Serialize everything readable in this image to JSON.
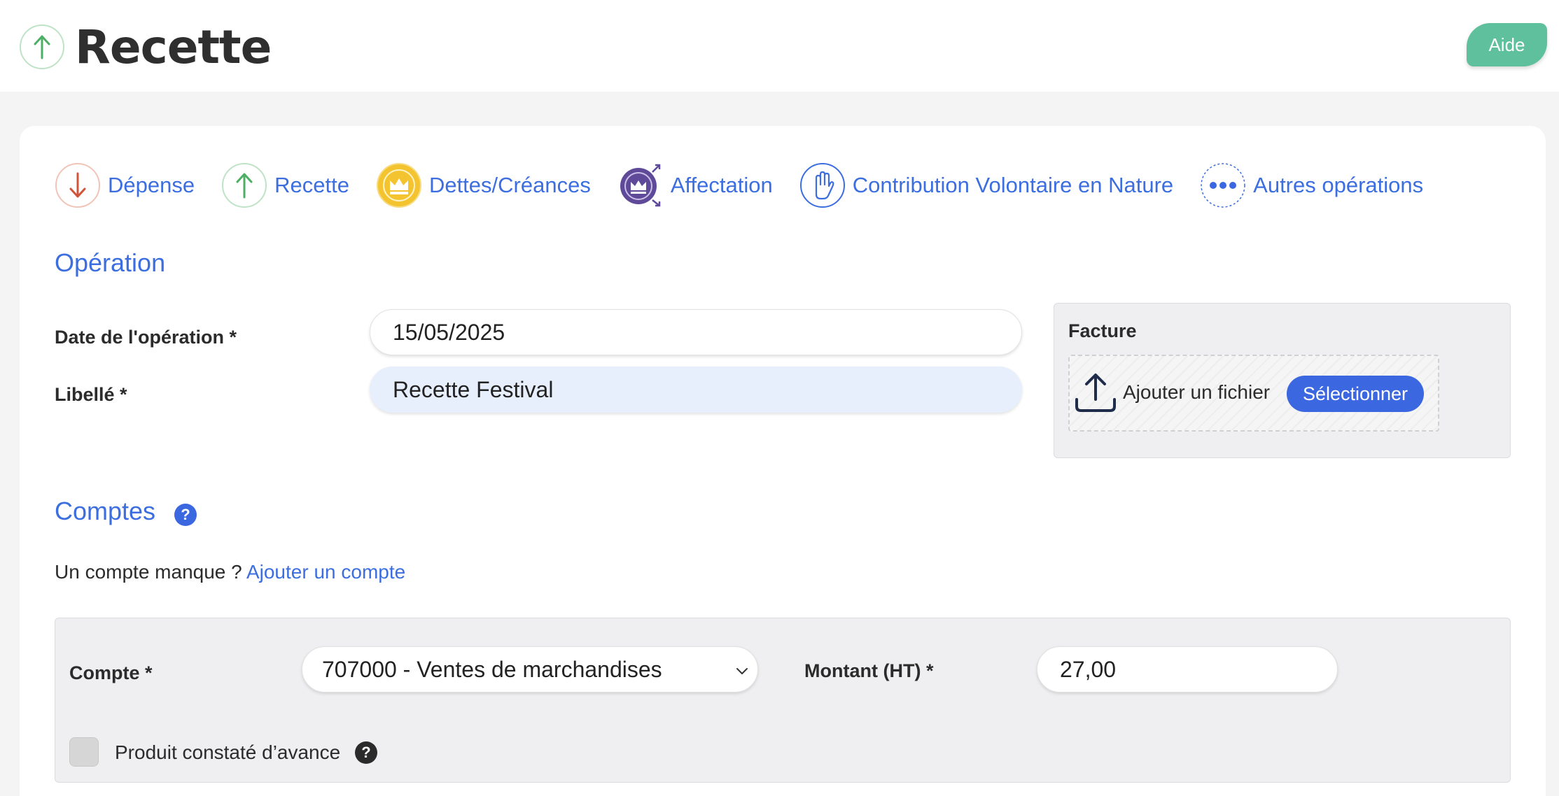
{
  "header": {
    "title": "Recette",
    "help_label": "Aide"
  },
  "tabs": [
    {
      "label": "Dépense",
      "icon": "arrow-down-icon"
    },
    {
      "label": "Recette",
      "icon": "arrow-up-icon"
    },
    {
      "label": "Dettes/Créances",
      "icon": "crown-icon"
    },
    {
      "label": "Affectation",
      "icon": "crown-transfer-icon"
    },
    {
      "label": "Contribution Volontaire en Nature",
      "icon": "hand-icon"
    },
    {
      "label": "Autres opérations",
      "icon": "more-dots-icon"
    }
  ],
  "operation": {
    "section_title": "Opération",
    "date_label": "Date de l'opération *",
    "date_value": "15/05/2025",
    "libelle_label": "Libellé *",
    "libelle_value": "Recette Festival"
  },
  "facture": {
    "title": "Facture",
    "dropzone_text": "Ajouter un fichier",
    "select_label": "Sélectionner"
  },
  "comptes": {
    "section_title": "Comptes",
    "missing_text": "Un compte manque ?",
    "add_link": "Ajouter un compte",
    "compte_label": "Compte *",
    "compte_value": "707000 - Ventes de marchandises",
    "montant_label": "Montant (HT) *",
    "montant_value": "27,00",
    "pca_label": "Produit constaté d’avance"
  },
  "colors": {
    "accent_blue": "#3c6ee0",
    "help_green": "#5fc09e",
    "expense_red": "#d0533a",
    "income_green": "#4caf64",
    "debt_yellow": "#f4c430",
    "allocation_purple": "#5e4a99"
  }
}
